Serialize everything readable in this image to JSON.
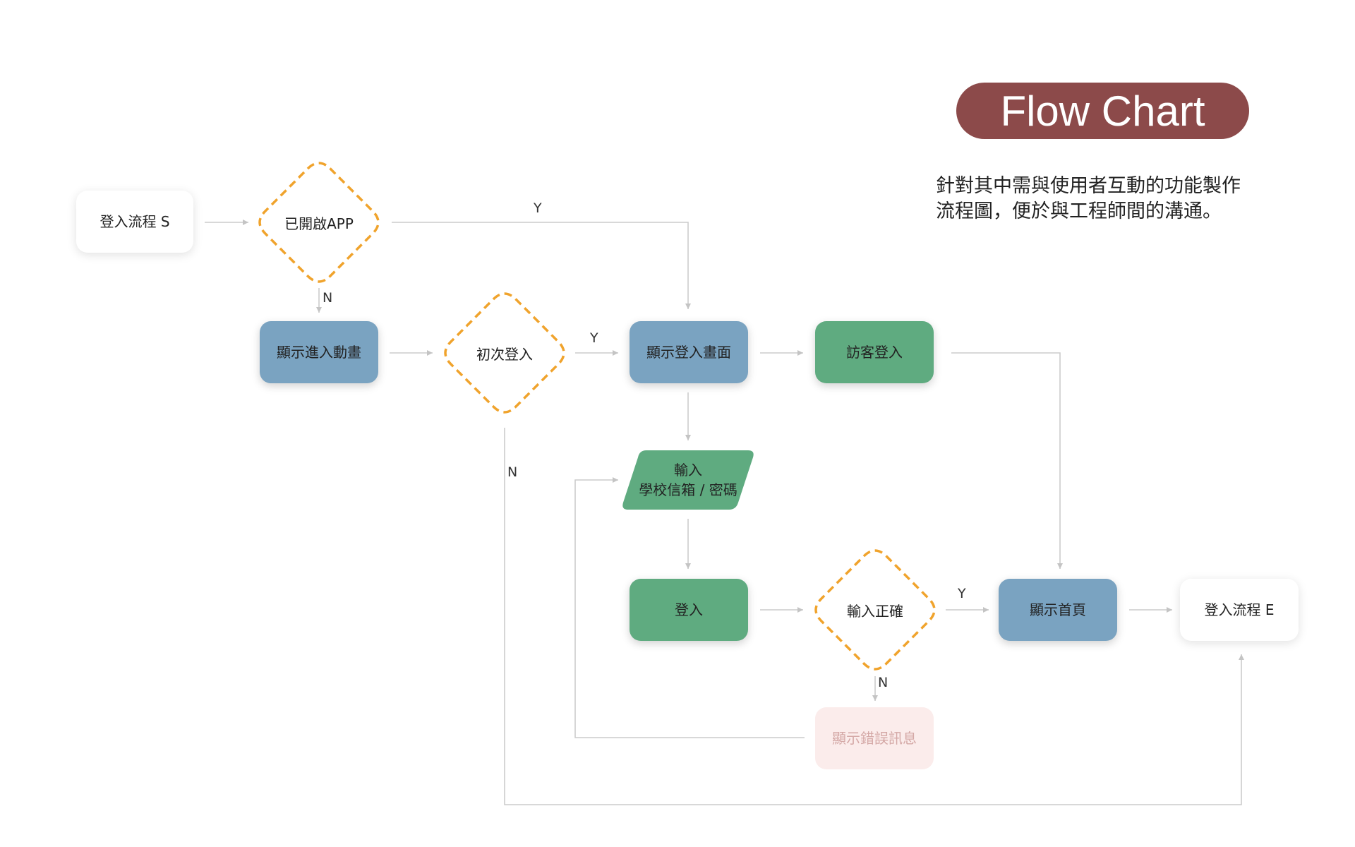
{
  "title": "Flow Chart",
  "description": [
    "針對其中需與使用者互動的功能製作",
    "流程圖，便於與工程師間的溝通。"
  ],
  "colors": {
    "title_bg": "#8c4a4a",
    "process_blue": "#7aa3c1",
    "process_green": "#5fab80",
    "decision_stroke": "#f0a32c",
    "error_bg": "#fbeceb",
    "error_text": "#d4a8a6",
    "connector": "#cccccc"
  },
  "nodes": {
    "start": "登入流程 S",
    "app_opened": "已開啟APP",
    "show_intro": "顯示進入動畫",
    "first_login": "初次登入",
    "show_login": "顯示登入畫面",
    "guest_login": "訪客登入",
    "input_line1": "輸入",
    "input_line2": "學校信箱 / 密碼",
    "login": "登入",
    "input_correct": "輸入正確",
    "show_home": "顯示首頁",
    "end": "登入流程 E",
    "show_error": "顯示錯誤訊息"
  },
  "edge_labels": {
    "app_yes": "Y",
    "app_no": "N",
    "first_yes": "Y",
    "first_no": "N",
    "correct_yes": "Y",
    "correct_no": "N"
  }
}
